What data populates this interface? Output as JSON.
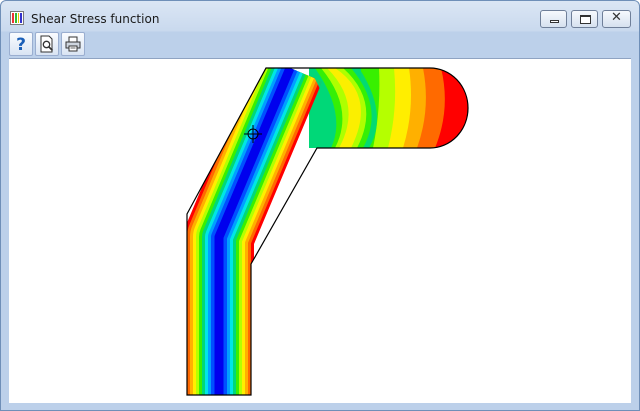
{
  "window": {
    "title": "Shear Stress function",
    "controls": {
      "minimize": "minimize",
      "maximize": "maximize",
      "close": "✕"
    }
  },
  "toolbar": {
    "buttons": [
      {
        "name": "help",
        "icon": "help-icon"
      },
      {
        "name": "print-preview",
        "icon": "print-preview-icon"
      },
      {
        "name": "print",
        "icon": "printer-icon"
      }
    ]
  },
  "plot": {
    "type": "filled contour plot",
    "colormap": [
      "#ff0000",
      "#ff6a00",
      "#ffb000",
      "#ffee00",
      "#b5ff00",
      "#38f000",
      "#00d878",
      "#00e6e6",
      "#00a0ff",
      "#0050ff",
      "#0000ee"
    ],
    "cursor": "crosshair"
  }
}
